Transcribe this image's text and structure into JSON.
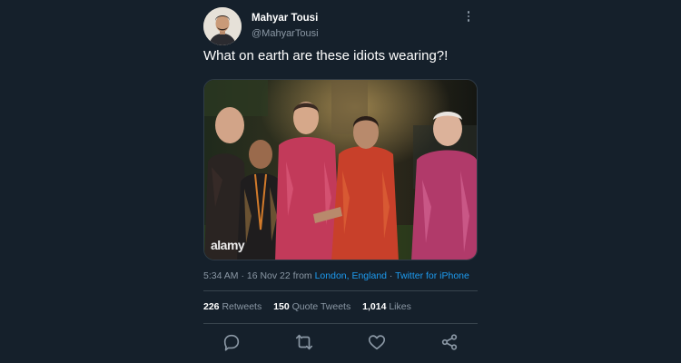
{
  "tweet": {
    "author_name": "Mahyar Tousi",
    "author_handle": "@MahyarTousi",
    "text": "What on earth are these idiots wearing?!",
    "media_watermark": "alamy",
    "time": "5:34 AM",
    "date": "16 Nov 22",
    "from_word": "from",
    "location": "London, England",
    "source": "Twitter for iPhone",
    "separator": "·"
  },
  "stats": {
    "retweets_count": "226",
    "retweets_label": "Retweets",
    "quote_count": "150",
    "quote_label": "Quote Tweets",
    "likes_count": "1,014",
    "likes_label": "Likes"
  },
  "actions": [
    {
      "icon": "reply-icon"
    },
    {
      "icon": "retweet-icon"
    },
    {
      "icon": "like-icon"
    },
    {
      "icon": "share-icon"
    }
  ],
  "colors": {
    "background": "#15202b",
    "text_primary": "#ffffff",
    "text_secondary": "#8b98a5",
    "link": "#1d9bf0",
    "divider": "#38444d"
  }
}
